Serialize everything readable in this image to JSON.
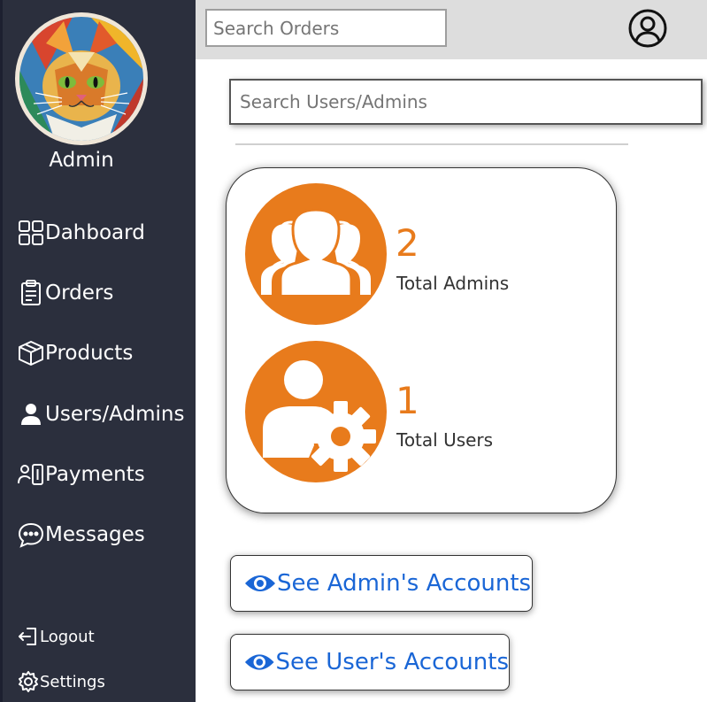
{
  "profile": {
    "name": "Admin"
  },
  "sidebar": {
    "items": [
      {
        "label": "Dahboard",
        "icon": "grid-icon"
      },
      {
        "label": "Orders",
        "icon": "clipboard-icon"
      },
      {
        "label": "Products",
        "icon": "box-icon"
      },
      {
        "label": "Users/Admins",
        "icon": "person-icon"
      },
      {
        "label": "Payments",
        "icon": "payment-person-icon"
      },
      {
        "label": "Messages",
        "icon": "chat-icon"
      }
    ],
    "bottom": [
      {
        "label": "Logout",
        "icon": "logout-icon"
      },
      {
        "label": "Settings",
        "icon": "gear-icon"
      }
    ]
  },
  "topbar": {
    "search_placeholder": "Search Orders",
    "profile_icon": "user-circle-icon"
  },
  "main": {
    "search_placeholder": "Search Users/Admins",
    "stats": [
      {
        "value": "2",
        "label": "Total Admins",
        "icon": "group-icon"
      },
      {
        "value": "1",
        "label": "Total Users",
        "icon": "user-gear-icon"
      }
    ],
    "buttons": [
      {
        "label": "See Admin's Accounts",
        "icon": "eye-icon"
      },
      {
        "label": "See User's Accounts",
        "icon": "eye-icon"
      }
    ]
  },
  "colors": {
    "sidebar_bg": "#2b2f3d",
    "accent": "#e87b1c",
    "link": "#1a66d6",
    "topbar_bg": "#dddddd"
  }
}
